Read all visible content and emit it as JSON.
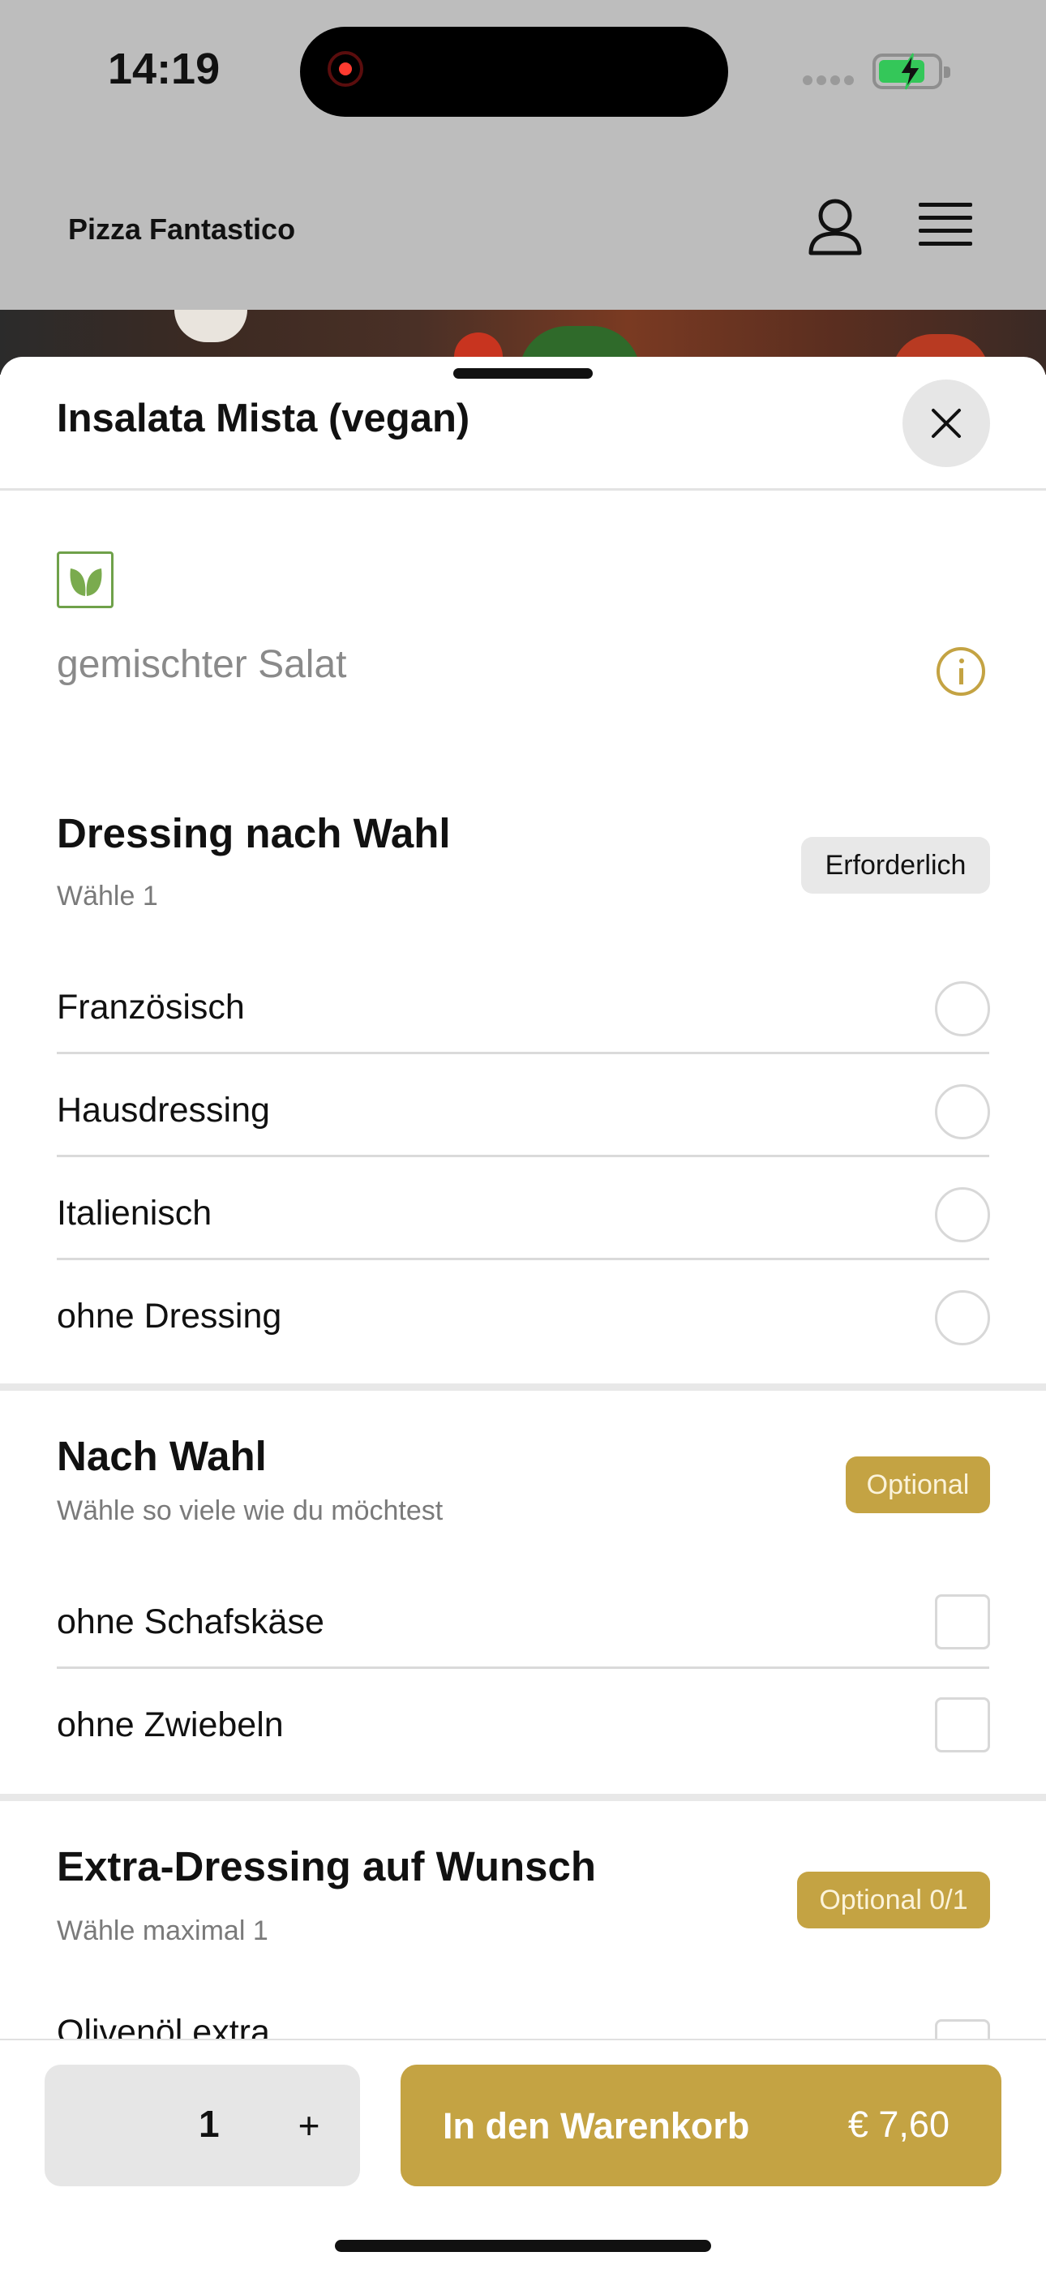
{
  "status_bar": {
    "time": "14:19",
    "battery": "charging"
  },
  "header": {
    "brand": "Pizza Fantastico",
    "icons": [
      "user-icon",
      "menu-icon"
    ]
  },
  "sheet": {
    "title": "Insalata Mista (vegan)",
    "badge_icon": "vegan-leaf-icon",
    "description": "gemischter Salat"
  },
  "sections": [
    {
      "title": "Dressing nach Wahl",
      "subtitle": "Wähle 1",
      "tag": "Erforderlich",
      "type": "radio",
      "options": [
        "Französisch",
        "Hausdressing",
        "Italienisch",
        "ohne Dressing"
      ]
    },
    {
      "title": "Nach Wahl",
      "subtitle": "Wähle so viele wie du möchtest",
      "tag": "Optional",
      "type": "checkbox",
      "options": [
        "ohne Schafskäse",
        "ohne Zwiebeln"
      ]
    },
    {
      "title": "Extra-Dressing auf Wunsch",
      "subtitle": "Wähle maximal 1",
      "tag": "Optional 0/1",
      "type": "checkbox",
      "options": [
        "Olivenöl extra"
      ]
    }
  ],
  "footer": {
    "quantity": "1",
    "plus_label": "+",
    "cart_label": "In den Warenkorb",
    "price": "€ 7,60"
  },
  "colors": {
    "accent": "#c4a343",
    "vegan_green": "#6fa14a",
    "dim_overlay": "#bdbdbd"
  }
}
